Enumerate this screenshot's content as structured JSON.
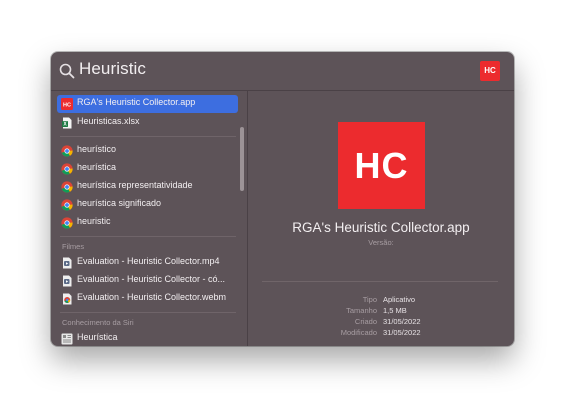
{
  "search": {
    "query": "Heuristic",
    "app_badge": "HC"
  },
  "results": {
    "top_hit": [
      {
        "label": "RGA's Heuristic Collector.app",
        "icon": "hc-app-icon",
        "selected": true
      },
      {
        "label": "Heuristicas.xlsx",
        "icon": "excel-file-icon",
        "selected": false
      }
    ],
    "suggestions": [
      {
        "label": "heurístico",
        "icon": "chrome-icon"
      },
      {
        "label": "heurística",
        "icon": "chrome-icon"
      },
      {
        "label": "heurística representatividade",
        "icon": "chrome-icon"
      },
      {
        "label": "heurística significado",
        "icon": "chrome-icon"
      },
      {
        "label": "heuristic",
        "icon": "chrome-icon"
      }
    ],
    "movies_header": "Filmes",
    "movies": [
      {
        "label": "Evaluation - Heuristic Collector.mp4",
        "icon": "video-file-icon"
      },
      {
        "label": "Evaluation - Heuristic Collector - có...",
        "icon": "video-file-icon"
      },
      {
        "label": "Evaluation - Heuristic Collector.webm",
        "icon": "chrome-file-icon"
      }
    ],
    "siri_header": "Conhecimento da Siri",
    "siri": [
      {
        "label": "Heurística",
        "icon": "siri-knowledge-icon"
      }
    ]
  },
  "preview": {
    "logo_text": "HC",
    "title": "RGA's Heuristic Collector.app",
    "subtitle": "Versão:",
    "metadata": [
      {
        "key": "Tipo",
        "value": "Aplicativo"
      },
      {
        "key": "Tamanho",
        "value": "1,5 MB"
      },
      {
        "key": "Criado",
        "value": "31/05/2022"
      },
      {
        "key": "Modificado",
        "value": "31/05/2022"
      }
    ]
  },
  "colors": {
    "window_bg": "#5d5358",
    "selection": "#3d6ee0",
    "brand_red": "#ec2b2e",
    "text": "#f3eff1",
    "muted_text": "#a79da2"
  }
}
